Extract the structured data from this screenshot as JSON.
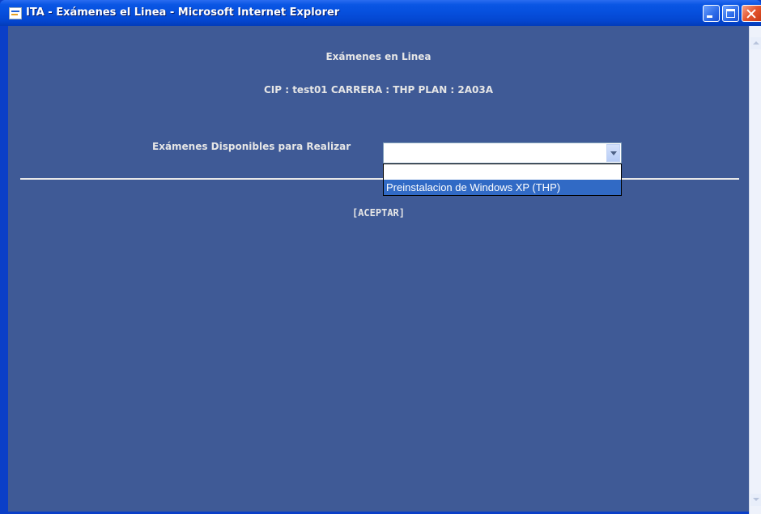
{
  "window": {
    "title": "ITA - Exámenes el Linea - Microsoft Internet Explorer",
    "icon": "ie-page-icon"
  },
  "page": {
    "heading": "Exámenes en Linea",
    "student_info": "CIP : test01 CARRERA : THP PLAN : 2A03A",
    "exam_label": "Exámenes Disponibles para Realizar",
    "exam_select": {
      "selected_value": "",
      "options": [
        "",
        "Preinstalacion de Windows XP (THP)"
      ]
    },
    "accept_label": "[ACEPTAR]"
  },
  "colors": {
    "content_bg": "#3f5a96",
    "text": "#e6e6e6",
    "titlebar": "#0650de",
    "highlight": "#316ac5"
  }
}
